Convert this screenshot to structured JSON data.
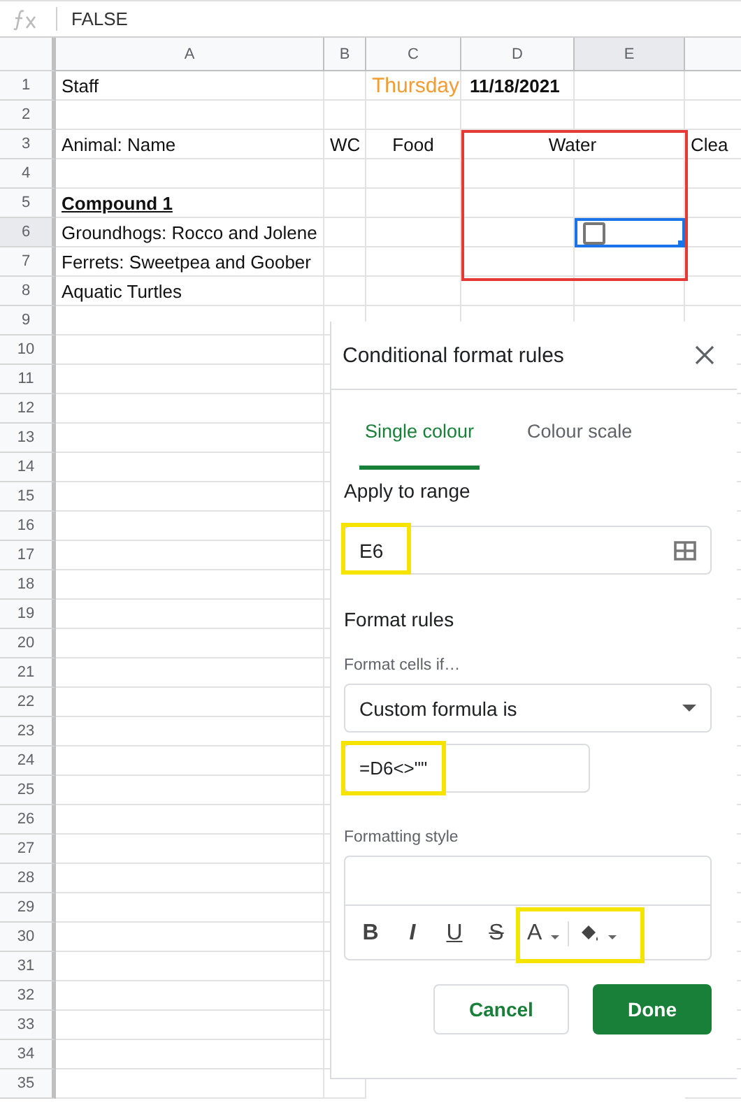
{
  "formula_bar": {
    "value": "FALSE"
  },
  "columns": [
    {
      "label": "A",
      "selected": false
    },
    {
      "label": "B",
      "selected": false
    },
    {
      "label": "C",
      "selected": false
    },
    {
      "label": "D",
      "selected": false
    },
    {
      "label": "E",
      "selected": true
    }
  ],
  "sheet": {
    "red_frame": true
  },
  "rows": [
    {
      "number": "1",
      "selected": false,
      "cells": {
        "a": {
          "text": "Staff",
          "kind": "plain"
        },
        "c": {
          "text": "Thursday",
          "kind": "accent"
        },
        "d": {
          "text": "11/18/2021",
          "kind": "bold"
        }
      }
    },
    {
      "number": "2",
      "selected": false,
      "cells": {}
    },
    {
      "number": "3",
      "selected": false,
      "cells": {
        "a": {
          "text": "Animal: Name",
          "kind": "plain"
        },
        "b": {
          "text": "WC",
          "kind": "plain"
        },
        "c": {
          "text": "Food",
          "kind": "centered"
        },
        "d": {
          "text": "Water",
          "kind": "spanning"
        },
        "f": {
          "text": "Clea",
          "kind": "plain"
        }
      }
    },
    {
      "number": "4",
      "selected": false,
      "cells": {}
    },
    {
      "number": "5",
      "selected": false,
      "cells": {
        "a": {
          "text": "Compound 1",
          "kind": "heading"
        }
      }
    },
    {
      "number": "6",
      "selected": true,
      "cells": {
        "a": {
          "text": "Groundhogs: Rocco and Jolene",
          "kind": "plain"
        },
        "e": {
          "kind": "checkbox",
          "checked": false,
          "selected": true
        }
      }
    },
    {
      "number": "7",
      "selected": false,
      "cells": {
        "a": {
          "text": "Ferrets: Sweetpea and Goober",
          "kind": "plain"
        }
      }
    },
    {
      "number": "8",
      "selected": false,
      "cells": {
        "a": {
          "text": "Aquatic Turtles",
          "kind": "plain"
        }
      }
    },
    {
      "number": "9",
      "selected": false,
      "cells": {}
    },
    {
      "number": "10",
      "selected": false,
      "cells": {}
    },
    {
      "number": "11",
      "selected": false,
      "cells": {}
    },
    {
      "number": "12",
      "selected": false,
      "cells": {}
    },
    {
      "number": "13",
      "selected": false,
      "cells": {}
    },
    {
      "number": "14",
      "selected": false,
      "cells": {}
    },
    {
      "number": "15",
      "selected": false,
      "cells": {}
    },
    {
      "number": "16",
      "selected": false,
      "cells": {}
    },
    {
      "number": "17",
      "selected": false,
      "cells": {}
    },
    {
      "number": "18",
      "selected": false,
      "cells": {}
    },
    {
      "number": "19",
      "selected": false,
      "cells": {}
    },
    {
      "number": "20",
      "selected": false,
      "cells": {}
    },
    {
      "number": "21",
      "selected": false,
      "cells": {}
    },
    {
      "number": "22",
      "selected": false,
      "cells": {}
    },
    {
      "number": "23",
      "selected": false,
      "cells": {}
    },
    {
      "number": "24",
      "selected": false,
      "cells": {}
    },
    {
      "number": "25",
      "selected": false,
      "cells": {}
    },
    {
      "number": "26",
      "selected": false,
      "cells": {}
    },
    {
      "number": "27",
      "selected": false,
      "cells": {}
    },
    {
      "number": "28",
      "selected": false,
      "cells": {}
    },
    {
      "number": "29",
      "selected": false,
      "cells": {}
    },
    {
      "number": "30",
      "selected": false,
      "cells": {}
    },
    {
      "number": "31",
      "selected": false,
      "cells": {}
    },
    {
      "number": "32",
      "selected": false,
      "cells": {}
    },
    {
      "number": "33",
      "selected": false,
      "cells": {}
    },
    {
      "number": "34",
      "selected": false,
      "cells": {}
    },
    {
      "number": "35",
      "selected": false,
      "cells": {}
    }
  ],
  "panel": {
    "title": "Conditional format rules",
    "tabs": [
      {
        "label": "Single colour",
        "selected": true
      },
      {
        "label": "Colour scale",
        "selected": false
      }
    ],
    "apply_label": "Apply to range",
    "range_field": {
      "value": "E6",
      "highlighted": true
    },
    "rules_label": "Format rules",
    "condition_label": "Format cells if…",
    "condition_dropdown": {
      "value": "Custom formula is"
    },
    "formula_field": {
      "value": "=D6<>\"\"",
      "highlighted": true
    },
    "style_label": "Formatting style",
    "style_buttons": [
      {
        "kind": "bold",
        "label": "B"
      },
      {
        "kind": "italic",
        "label": "I"
      },
      {
        "kind": "underline",
        "label": "U"
      },
      {
        "kind": "strike",
        "label": "S"
      }
    ],
    "colour_buttons": {
      "text_label": "A",
      "highlighted": true
    },
    "buttons": [
      {
        "label": "Cancel",
        "kind": "secondary"
      },
      {
        "label": "Done",
        "kind": "primary"
      }
    ]
  }
}
